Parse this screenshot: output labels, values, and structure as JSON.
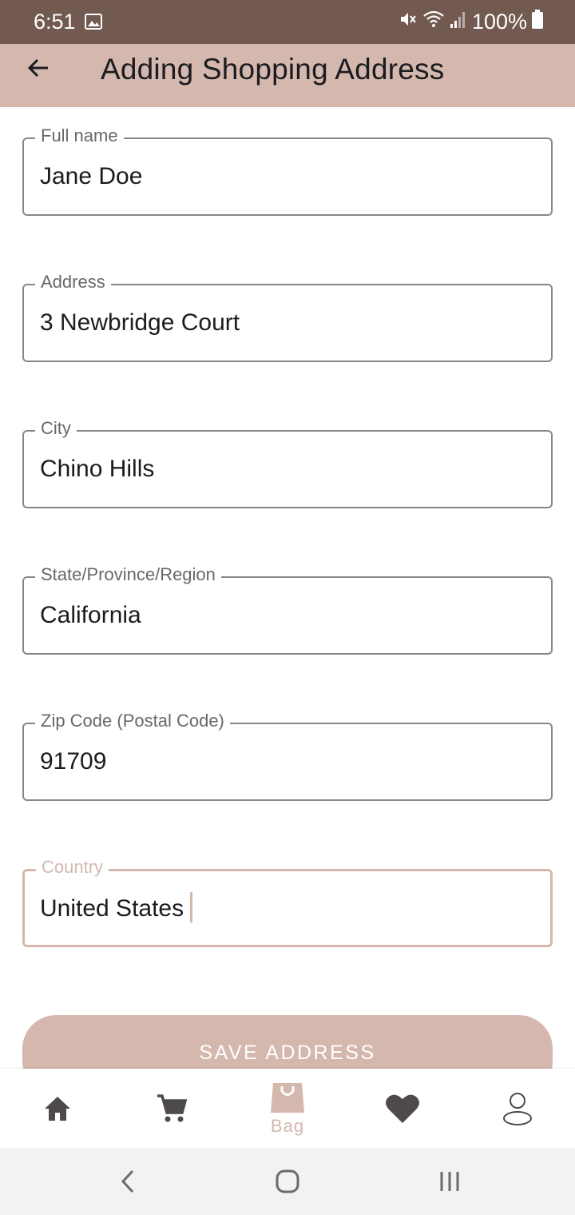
{
  "status_bar": {
    "time": "6:51",
    "battery": "100%"
  },
  "app_bar": {
    "title": "Adding Shopping Address"
  },
  "form": {
    "fields": [
      {
        "label": "Full name",
        "value": "Jane Doe"
      },
      {
        "label": "Address",
        "value": "3 Newbridge Court"
      },
      {
        "label": "City",
        "value": "Chino Hills"
      },
      {
        "label": "State/Province/Region",
        "value": "California"
      },
      {
        "label": "Zip Code (Postal Code)",
        "value": "91709"
      },
      {
        "label": "Country",
        "value": "United States"
      }
    ],
    "save_label": "SAVE ADDRESS"
  },
  "bottom_nav": {
    "items": [
      {
        "icon": "home-icon"
      },
      {
        "icon": "cart-icon"
      },
      {
        "icon": "bag-icon",
        "label": "Bag",
        "active": true
      },
      {
        "icon": "heart-icon"
      },
      {
        "icon": "profile-icon"
      }
    ]
  },
  "colors": {
    "status_bar": "#725a50",
    "accent": "#d4b8ae",
    "text": "#1c1b1f",
    "icon": "#4e4a4a"
  }
}
